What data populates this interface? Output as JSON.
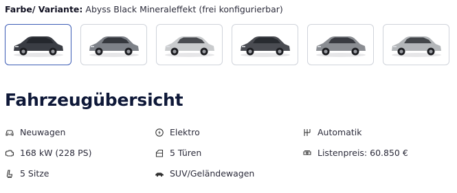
{
  "color_selection": {
    "label": "Farbe/ Variante:",
    "value": "Abyss Black Mineraleffekt (frei konfigurierbar)",
    "swatches": [
      {
        "name": "abyss-black",
        "body_color": "#3a3d44",
        "selected": true
      },
      {
        "name": "gravity-gray",
        "body_color": "#7d8188",
        "selected": false
      },
      {
        "name": "atlas-white",
        "body_color": "#c9cbcd",
        "selected": false
      },
      {
        "name": "phantom-black",
        "body_color": "#4a4c52",
        "selected": false
      },
      {
        "name": "shooting-star-gray",
        "body_color": "#8a8d92",
        "selected": false
      },
      {
        "name": "cyber-gray",
        "body_color": "#b3b6b9",
        "selected": false
      }
    ]
  },
  "overview": {
    "title": "Fahrzeugübersicht",
    "features": [
      {
        "icon": "car-icon",
        "text": "Neuwagen"
      },
      {
        "icon": "fuel-electric-icon",
        "text": "Elektro"
      },
      {
        "icon": "gearshift-icon",
        "text": "Automatik"
      },
      {
        "icon": "engine-icon",
        "text": "168 kW (228 PS)"
      },
      {
        "icon": "door-icon",
        "text": "5 Türen"
      },
      {
        "icon": "price-tag-icon",
        "text": "Listenpreis: 60.850 €"
      },
      {
        "icon": "seat-icon",
        "text": "5 Sitze"
      },
      {
        "icon": "suv-icon",
        "text": "SUV/Geländewagen"
      }
    ]
  }
}
